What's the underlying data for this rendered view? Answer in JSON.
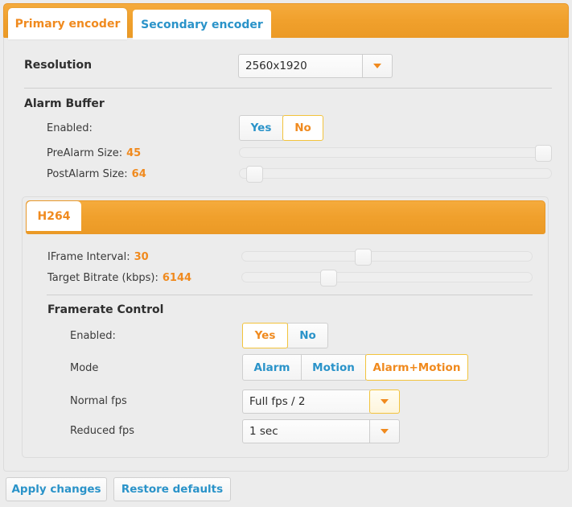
{
  "tabs": [
    {
      "label": "Primary encoder",
      "active": true
    },
    {
      "label": "Secondary encoder",
      "active": false
    }
  ],
  "resolution": {
    "label": "Resolution",
    "value": "2560x1920"
  },
  "alarm_buffer": {
    "title": "Alarm Buffer",
    "enabled_label": "Enabled:",
    "enabled_options": [
      "Yes",
      "No"
    ],
    "enabled_selected": "No",
    "prealarm_label": "PreAlarm Size:",
    "prealarm_value": "45",
    "postalarm_label": "PostAlarm Size:",
    "postalarm_value": "64"
  },
  "h264": {
    "tab_label": "H264",
    "iframe_label": "IFrame Interval:",
    "iframe_value": "30",
    "bitrate_label": "Target Bitrate (kbps):",
    "bitrate_value": "6144",
    "framerate": {
      "title": "Framerate Control",
      "enabled_label": "Enabled:",
      "enabled_options": [
        "Yes",
        "No"
      ],
      "enabled_selected": "Yes",
      "mode_label": "Mode",
      "mode_options": [
        "Alarm",
        "Motion",
        "Alarm+Motion"
      ],
      "mode_selected": "Alarm+Motion",
      "normal_fps_label": "Normal fps",
      "normal_fps_value": "Full fps / 2",
      "reduced_fps_label": "Reduced fps",
      "reduced_fps_value": "1 sec"
    }
  },
  "footer": {
    "apply_label": "Apply changes",
    "restore_label": "Restore defaults"
  },
  "colors": {
    "accent_orange": "#f08a1e",
    "bar_orange": "#f0a02c",
    "link_blue": "#2a93c9",
    "selected_border": "#f2c33c",
    "panel_bg": "#ececec"
  }
}
